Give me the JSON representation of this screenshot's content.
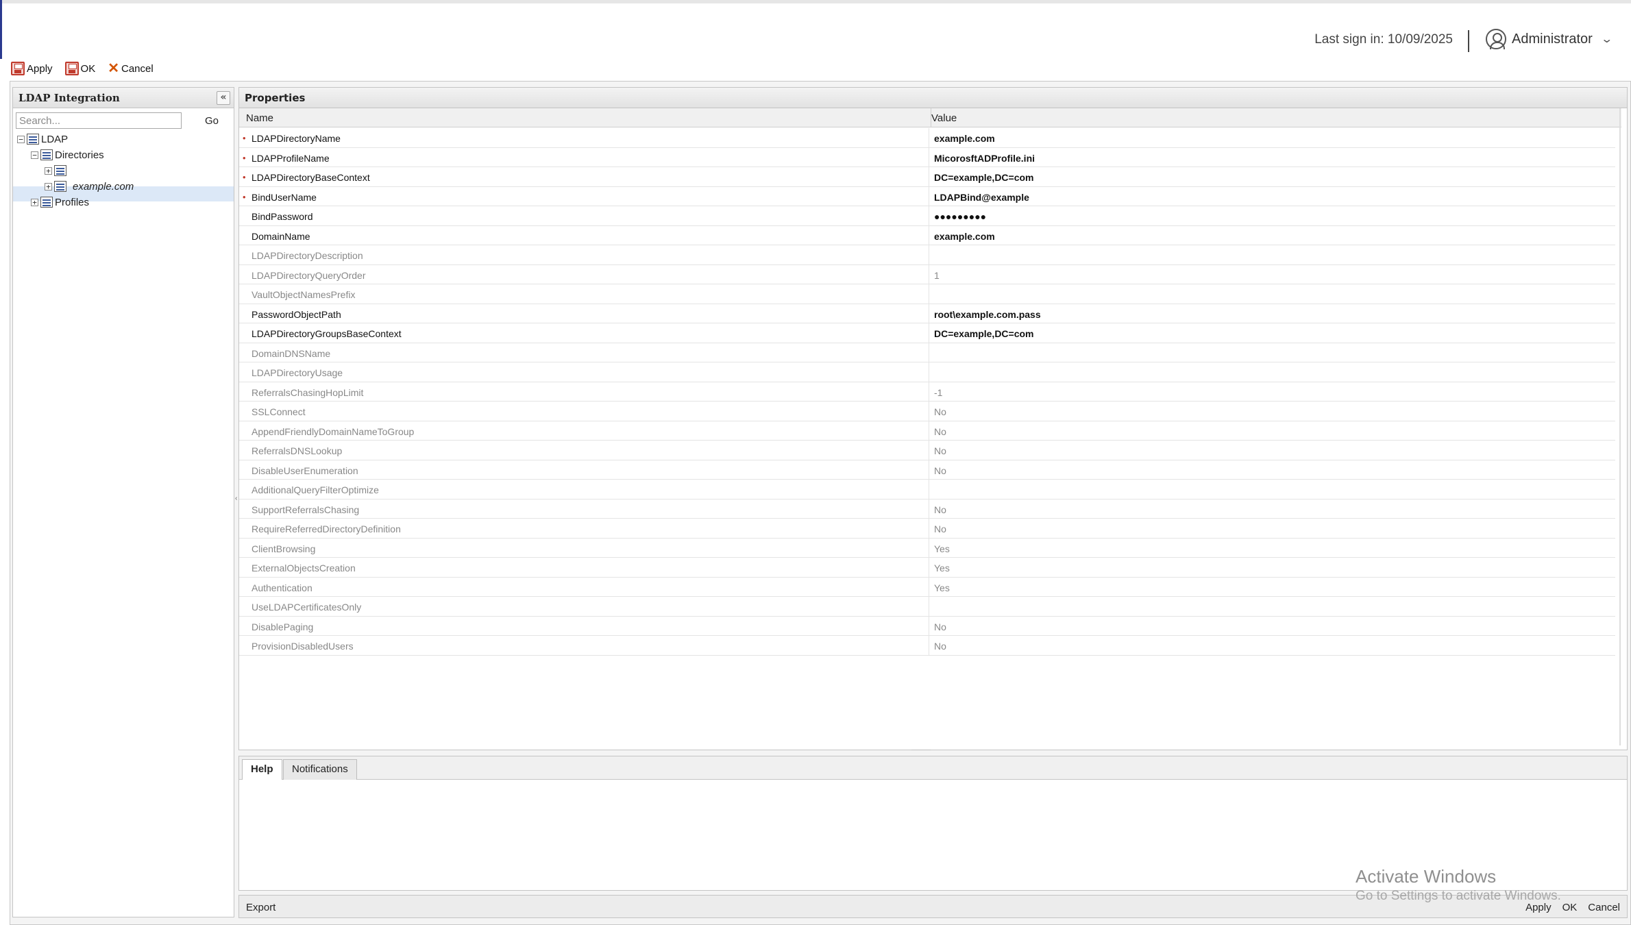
{
  "header": {
    "last_signin": "Last sign in: 10/09/2025",
    "user_name": "Administrator",
    "user_icon": "user-circle-icon",
    "dropdown_icon": "chevron-down-icon"
  },
  "toolbar": {
    "apply": "Apply",
    "ok": "OK",
    "cancel": "Cancel"
  },
  "left_panel": {
    "title": "LDAP Integration",
    "collapse_glyph": "«",
    "search_placeholder": "Search...",
    "go": "Go",
    "tree": {
      "root": "LDAP",
      "directories": "Directories",
      "unnamed_node": "",
      "selected_node": "example.com",
      "profiles": "Profiles"
    }
  },
  "properties": {
    "title": "Properties",
    "col_name": "Name",
    "col_value": "Value",
    "rows": [
      {
        "name": "LDAPDirectoryName",
        "value": "example.com",
        "required": true,
        "active": true
      },
      {
        "name": "LDAPProfileName",
        "value": "MicorosftADProfile.ini",
        "required": true,
        "active": true
      },
      {
        "name": "LDAPDirectoryBaseContext",
        "value": "DC=example,DC=com",
        "required": true,
        "active": true
      },
      {
        "name": "BindUserName",
        "value": "LDAPBind@example",
        "required": true,
        "active": true
      },
      {
        "name": "BindPassword",
        "value": "●●●●●●●●●",
        "required": false,
        "active": true
      },
      {
        "name": "DomainName",
        "value": "example.com",
        "required": false,
        "active": true
      },
      {
        "name": "LDAPDirectoryDescription",
        "value": "",
        "required": false,
        "active": false
      },
      {
        "name": "LDAPDirectoryQueryOrder",
        "value": "1",
        "required": false,
        "active": false
      },
      {
        "name": "VaultObjectNamesPrefix",
        "value": "",
        "required": false,
        "active": false
      },
      {
        "name": "PasswordObjectPath",
        "value": "root\\example.com.pass",
        "required": false,
        "active": true
      },
      {
        "name": "LDAPDirectoryGroupsBaseContext",
        "value": "DC=example,DC=com",
        "required": false,
        "active": true
      },
      {
        "name": "DomainDNSName",
        "value": "",
        "required": false,
        "active": false
      },
      {
        "name": "LDAPDirectoryUsage",
        "value": "",
        "required": false,
        "active": false
      },
      {
        "name": "ReferralsChasingHopLimit",
        "value": "-1",
        "required": false,
        "active": false
      },
      {
        "name": "SSLConnect",
        "value": "No",
        "required": false,
        "active": false
      },
      {
        "name": "AppendFriendlyDomainNameToGroup",
        "value": "No",
        "required": false,
        "active": false
      },
      {
        "name": "ReferralsDNSLookup",
        "value": "No",
        "required": false,
        "active": false
      },
      {
        "name": "DisableUserEnumeration",
        "value": "No",
        "required": false,
        "active": false
      },
      {
        "name": "AdditionalQueryFilterOptimize",
        "value": "",
        "required": false,
        "active": false
      },
      {
        "name": "SupportReferralsChasing",
        "value": "No",
        "required": false,
        "active": false
      },
      {
        "name": "RequireReferredDirectoryDefinition",
        "value": "No",
        "required": false,
        "active": false
      },
      {
        "name": "ClientBrowsing",
        "value": "Yes",
        "required": false,
        "active": false
      },
      {
        "name": "ExternalObjectsCreation",
        "value": "Yes",
        "required": false,
        "active": false
      },
      {
        "name": "Authentication",
        "value": "Yes",
        "required": false,
        "active": false
      },
      {
        "name": "UseLDAPCertificatesOnly",
        "value": "",
        "required": false,
        "active": false
      },
      {
        "name": "DisablePaging",
        "value": "No",
        "required": false,
        "active": false
      },
      {
        "name": "ProvisionDisabledUsers",
        "value": "No",
        "required": false,
        "active": false
      }
    ]
  },
  "bottom": {
    "tab_help": "Help",
    "tab_notifications": "Notifications"
  },
  "footer": {
    "export": "Export",
    "apply": "Apply",
    "ok": "OK",
    "cancel": "Cancel"
  },
  "watermark": {
    "line1": "Activate Windows",
    "line2": "Go to Settings to activate Windows."
  }
}
